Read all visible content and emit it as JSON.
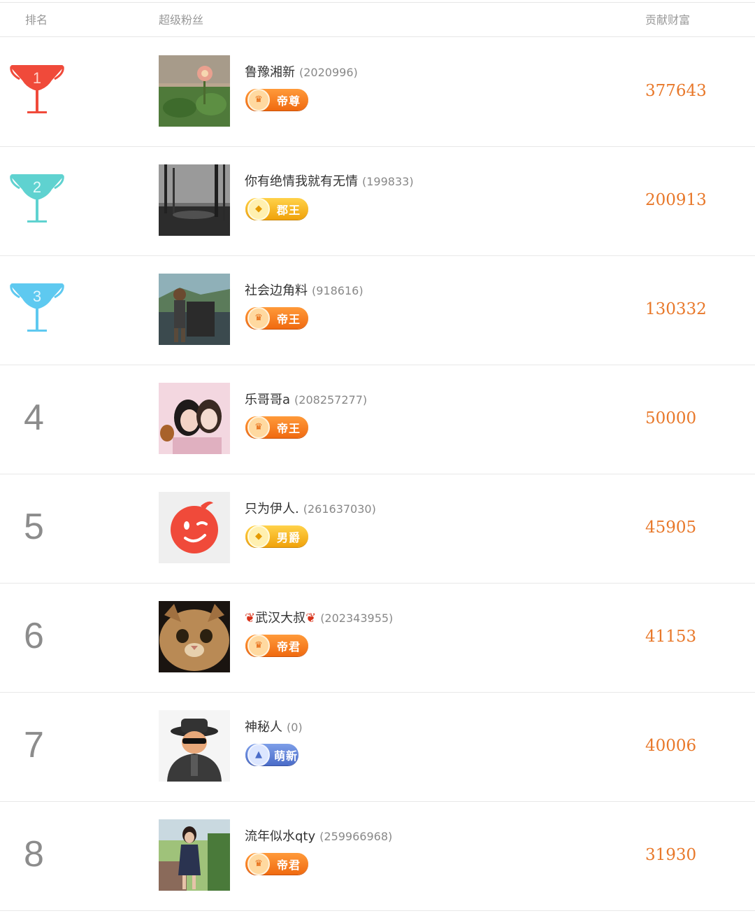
{
  "header": {
    "rank": "排名",
    "fan": "超级粉丝",
    "wealth": "贡献财富"
  },
  "colors": {
    "wealth": "#e8782a",
    "trophy_gold": "#f04a3a",
    "trophy_silver": "#5fd2d0",
    "trophy_bronze": "#5ec9f0"
  },
  "rows": [
    {
      "rank": "1",
      "trophy": "red-trophy-icon",
      "name": "鲁豫湘新",
      "uid": "(2020996)",
      "badge": "帝尊",
      "badge_style": "orange",
      "wealth": "377643",
      "avatar": "flower-plant-photo"
    },
    {
      "rank": "2",
      "trophy": "teal-trophy-icon",
      "name": "你有绝情我就有无情",
      "uid": "(199833)",
      "badge": "郡王",
      "badge_style": "gold",
      "wealth": "200913",
      "avatar": "misty-lake-photo"
    },
    {
      "rank": "3",
      "trophy": "blue-trophy-icon",
      "name": "社会边角料",
      "uid": "(918616)",
      "badge": "帝王",
      "badge_style": "orange",
      "wealth": "130332",
      "avatar": "man-cart-photo"
    },
    {
      "rank": "4",
      "name": "乐哥哥a",
      "uid": "(208257277)",
      "badge": "帝王",
      "badge_style": "orange",
      "wealth": "50000",
      "avatar": "two-girls-photo"
    },
    {
      "rank": "5",
      "name": "只为伊人.",
      "uid": "(261637030)",
      "badge": "男爵",
      "badge_style": "gold",
      "wealth": "45905",
      "avatar": "red-wink-face"
    },
    {
      "rank": "6",
      "name": "武汉大叔",
      "uid": "(202343955)",
      "badge": "帝君",
      "badge_style": "orange",
      "wealth": "41153",
      "avatar": "cat-face-photo"
    },
    {
      "rank": "7",
      "name": "神秘人",
      "uid": "(0)",
      "badge": "萌新",
      "badge_style": "blue",
      "wealth": "40006",
      "avatar": "spy-avatar"
    },
    {
      "rank": "8",
      "name": "流年似水qty",
      "uid": "(259966968)",
      "badge": "帝君",
      "badge_style": "orange",
      "wealth": "31930",
      "avatar": "woman-walking-photo"
    }
  ]
}
